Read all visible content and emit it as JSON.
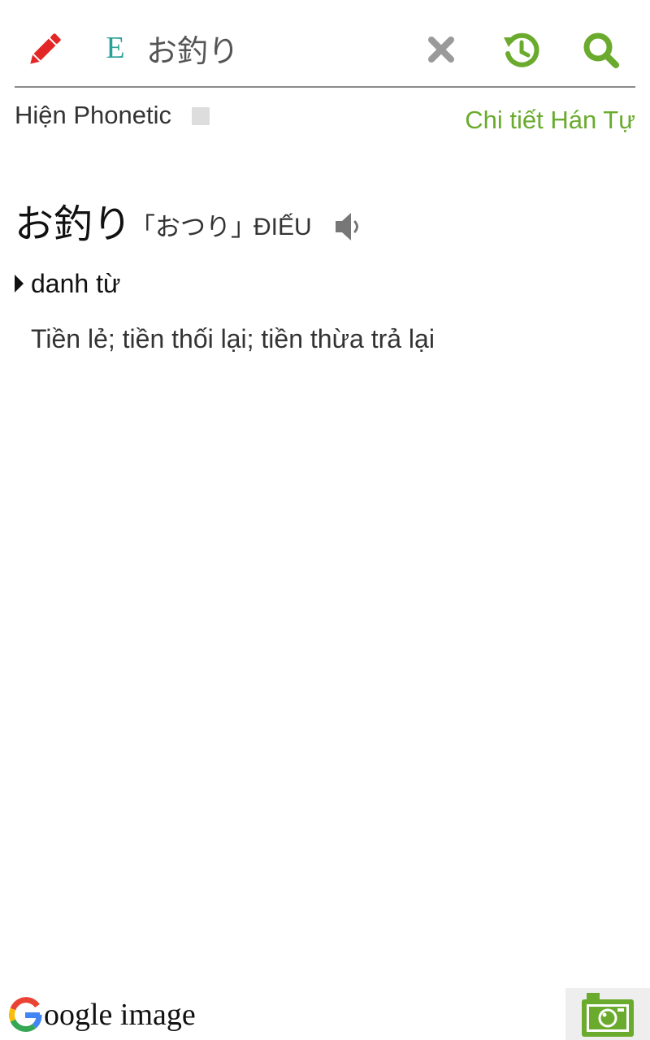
{
  "colors": {
    "accent_green": "#6aab2e",
    "pencil_red": "#e32626",
    "lang_teal": "#2aa198",
    "clear_gray": "#9a9a9a",
    "speaker_gray": "#777777"
  },
  "search_bar": {
    "pencil_icon": "pencil-icon",
    "language_code": "E",
    "query_value": "お釣り",
    "clear_icon": "close-icon",
    "history_icon": "history-icon",
    "search_icon": "search-icon"
  },
  "options": {
    "phonetic_label": "Hiện Phonetic",
    "phonetic_checked": false,
    "kanji_detail_link": "Chi tiết Hán Tự"
  },
  "entry": {
    "word": "お釣り",
    "reading": "「おつり」",
    "han_viet": "ĐIẾU",
    "speaker_icon": "speaker-icon",
    "part_of_speech": "danh từ",
    "meaning": "Tiền lẻ; tiền thối lại; tiền thừa trả lại"
  },
  "footer": {
    "google_logo": "google-g-icon",
    "google_image_text": "oogle image",
    "camera_icon": "camera-icon"
  }
}
